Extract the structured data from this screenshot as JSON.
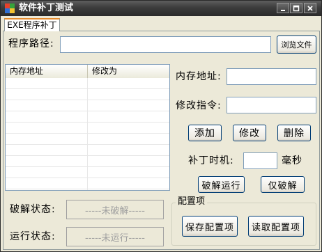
{
  "window": {
    "title": "软件补丁测试"
  },
  "tabs": [
    {
      "label": "EXE程序补丁"
    }
  ],
  "program_path": {
    "label": "程序路径:",
    "value": "",
    "browse_button": "浏览文件"
  },
  "list": {
    "columns": [
      "内存地址",
      "修改为"
    ],
    "rows": []
  },
  "memory_address": {
    "label": "内存地址:",
    "value": ""
  },
  "modify_instruction": {
    "label": "修改指令:",
    "value": ""
  },
  "actions": {
    "add": "添加",
    "modify": "修改",
    "delete": "删除"
  },
  "patch_timing": {
    "label": "补丁时机:",
    "value": "",
    "unit": "毫秒"
  },
  "run_buttons": {
    "crack_run": "破解运行",
    "crack_only": "仅破解"
  },
  "crack_status": {
    "label": "破解状态:",
    "value": "-----未破解-----"
  },
  "run_status": {
    "label": "运行状态:",
    "value": "-----未运行-----"
  },
  "config": {
    "title": "配置项",
    "save": "保存配置项",
    "load": "读取配置项"
  }
}
